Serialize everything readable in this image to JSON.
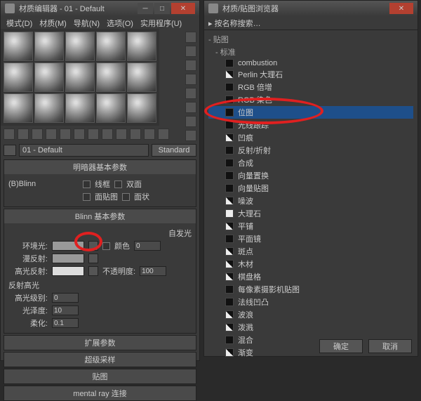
{
  "editor": {
    "title": "材质编辑器 - 01 - Default",
    "menu": [
      "模式(D)",
      "材质(M)",
      "导航(N)",
      "选项(O)",
      "实用程序(U)"
    ],
    "slot_name": "01 - Default",
    "type_btn": "Standard",
    "rollouts": {
      "shader": {
        "title": "明暗器基本参数",
        "shader": "(B)Blinn",
        "cb": [
          "线框",
          "双面",
          "面贴图",
          "面状"
        ]
      },
      "blinn": {
        "title": "Blinn 基本参数",
        "self_illum": "自发光",
        "color_lbl": "颜色",
        "ambient": "环境光:",
        "diffuse": "漫反射:",
        "specular": "高光反射:",
        "opacity_lbl": "不透明度:",
        "opacity": "100",
        "zero": "0"
      },
      "hl": {
        "title": "反射高光",
        "level": "高光级别:",
        "level_v": "0",
        "gloss": "光泽度:",
        "gloss_v": "10",
        "soft": "柔化:",
        "soft_v": "0.1"
      },
      "more": [
        "扩展参数",
        "超级采样",
        "贴图",
        "mental ray 连接"
      ]
    }
  },
  "browser": {
    "title": "材质/贴图浏览器",
    "search": "▸ 按名称搜索…",
    "group1": "- 贴图",
    "group2": "- 标准",
    "items": [
      {
        "n": "combustion",
        "c": "k"
      },
      {
        "n": "Perlin 大理石",
        "c": "g"
      },
      {
        "n": "RGB 倍增",
        "c": "k"
      },
      {
        "n": "RGB 染色",
        "c": "k"
      },
      {
        "n": "位图",
        "c": "k",
        "sel": true
      },
      {
        "n": "光线跟踪",
        "c": "k"
      },
      {
        "n": "凹痕",
        "c": "g"
      },
      {
        "n": "反射/折射",
        "c": "k"
      },
      {
        "n": "合成",
        "c": "k"
      },
      {
        "n": "向量置换",
        "c": "k"
      },
      {
        "n": "向量贴图",
        "c": "k"
      },
      {
        "n": "噪波",
        "c": "g"
      },
      {
        "n": "大理石",
        "c": "w"
      },
      {
        "n": "平铺",
        "c": "g"
      },
      {
        "n": "平面镜",
        "c": "k"
      },
      {
        "n": "斑点",
        "c": "g"
      },
      {
        "n": "木材",
        "c": "g"
      },
      {
        "n": "棋盘格",
        "c": "g"
      },
      {
        "n": "每像素摄影机贴图",
        "c": "k"
      },
      {
        "n": "法线凹凸",
        "c": "k"
      },
      {
        "n": "波浪",
        "c": "g"
      },
      {
        "n": "泼溅",
        "c": "g"
      },
      {
        "n": "混合",
        "c": "k"
      },
      {
        "n": "渐变",
        "c": "g"
      }
    ],
    "ok": "确定",
    "cancel": "取消"
  }
}
